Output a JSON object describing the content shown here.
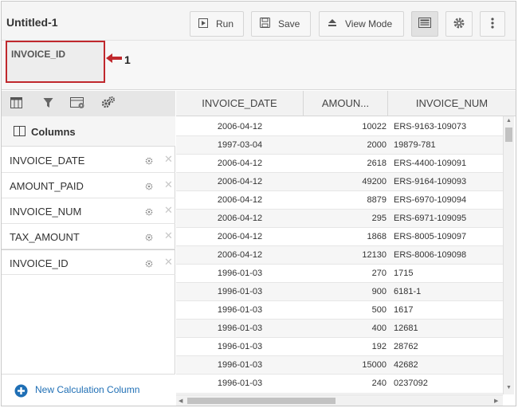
{
  "app": {
    "title": "Untitled-1"
  },
  "toolbar": {
    "run_label": "Run",
    "save_label": "Save",
    "viewmode_label": "View Mode"
  },
  "dropzone": {
    "item_label": "INVOICE_ID",
    "callout_number": "1"
  },
  "left_panel": {
    "header_label": "Columns",
    "columns": [
      "INVOICE_DATE",
      "AMOUNT_PAID",
      "INVOICE_NUM",
      "TAX_AMOUNT",
      "INVOICE_ID"
    ],
    "footer_label": "New Calculation Column"
  },
  "grid": {
    "headers": [
      "INVOICE_DATE",
      "AMOUN...",
      "INVOICE_NUM"
    ],
    "rows": [
      [
        "2006-04-12",
        "10022",
        "ERS-9163-109073"
      ],
      [
        "1997-03-04",
        "2000",
        "19879-781"
      ],
      [
        "2006-04-12",
        "2618",
        "ERS-4400-109091"
      ],
      [
        "2006-04-12",
        "49200",
        "ERS-9164-109093"
      ],
      [
        "2006-04-12",
        "8879",
        "ERS-6970-109094"
      ],
      [
        "2006-04-12",
        "295",
        "ERS-6971-109095"
      ],
      [
        "2006-04-12",
        "1868",
        "ERS-8005-109097"
      ],
      [
        "2006-04-12",
        "12130",
        "ERS-8006-109098"
      ],
      [
        "1996-01-03",
        "270",
        "1715"
      ],
      [
        "1996-01-03",
        "900",
        "6181-1"
      ],
      [
        "1996-01-03",
        "500",
        "1617"
      ],
      [
        "1996-01-03",
        "400",
        "12681"
      ],
      [
        "1996-01-03",
        "192",
        "28762"
      ],
      [
        "1996-01-03",
        "15000",
        "42682"
      ],
      [
        "1996-01-03",
        "240",
        "0237092"
      ]
    ]
  },
  "colors": {
    "accent": "#1f6fb5",
    "callout_border": "#c0282d"
  }
}
